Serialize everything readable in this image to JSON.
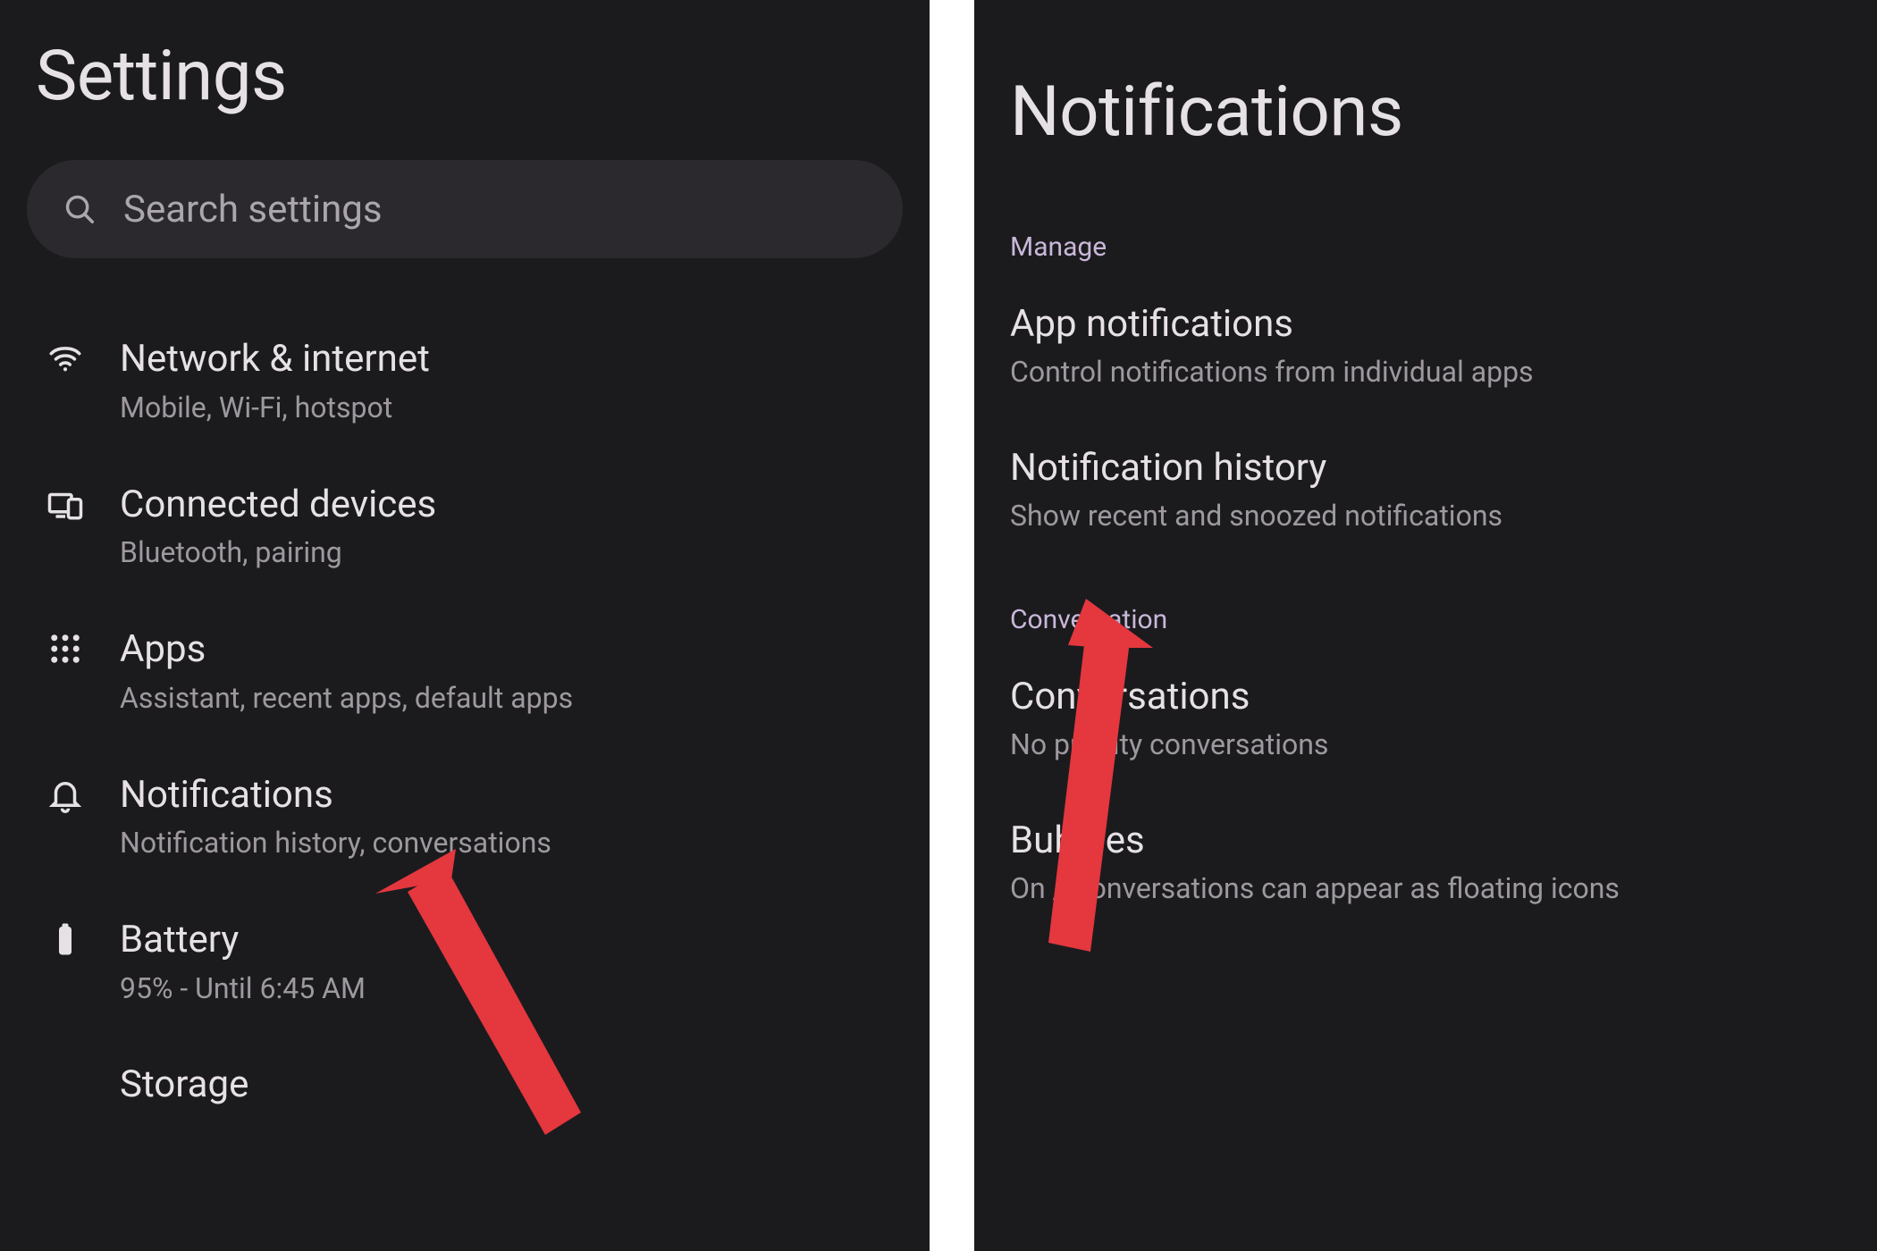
{
  "left": {
    "title": "Settings",
    "search_placeholder": "Search settings",
    "items": [
      {
        "icon": "wifi",
        "title": "Network & internet",
        "subtitle": "Mobile, Wi-Fi, hotspot"
      },
      {
        "icon": "devices",
        "title": "Connected devices",
        "subtitle": "Bluetooth, pairing"
      },
      {
        "icon": "apps",
        "title": "Apps",
        "subtitle": "Assistant, recent apps, default apps"
      },
      {
        "icon": "bell",
        "title": "Notifications",
        "subtitle": "Notification history, conversations"
      },
      {
        "icon": "battery",
        "title": "Battery",
        "subtitle": "95% - Until 6:45 AM"
      },
      {
        "icon": "storage",
        "title": "Storage",
        "subtitle": ""
      }
    ]
  },
  "right": {
    "title": "Notifications",
    "sections": [
      {
        "label": "Manage",
        "items": [
          {
            "title": "App notifications",
            "subtitle": "Control notifications from individual apps"
          },
          {
            "title": "Notification history",
            "subtitle": "Show recent and snoozed notifications"
          }
        ]
      },
      {
        "label": "Conversation",
        "items": [
          {
            "title": "Conversations",
            "subtitle": "No priority conversations"
          },
          {
            "title": "Bubbles",
            "subtitle": "On / Conversations can appear as floating icons"
          }
        ]
      }
    ]
  },
  "annotations": {
    "arrow_color": "#e4373e"
  }
}
